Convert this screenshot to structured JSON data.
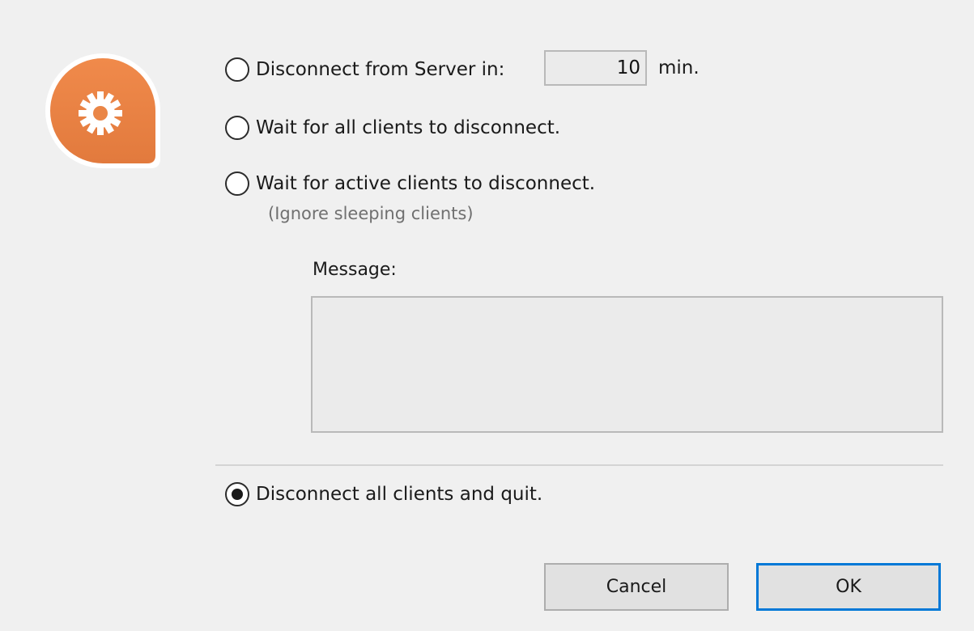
{
  "options": {
    "disconnect_in": {
      "label": "Disconnect from Server in:",
      "minutes": "10",
      "unit": "min.",
      "selected": false
    },
    "wait_all": {
      "label": "Wait for all clients to disconnect.",
      "selected": false
    },
    "wait_active": {
      "label": "Wait for active clients to disconnect.",
      "hint": "(Ignore sleeping clients)",
      "selected": false
    },
    "disconnect_all": {
      "label": "Disconnect all clients and quit.",
      "selected": true
    }
  },
  "message": {
    "label": "Message:",
    "value": ""
  },
  "buttons": {
    "cancel": "Cancel",
    "ok": "OK"
  },
  "icons": {
    "app": "server-gear-icon"
  },
  "colors": {
    "accent": "#0078d7",
    "icon_orange": "#ea8647",
    "background": "#f0f0f0"
  }
}
